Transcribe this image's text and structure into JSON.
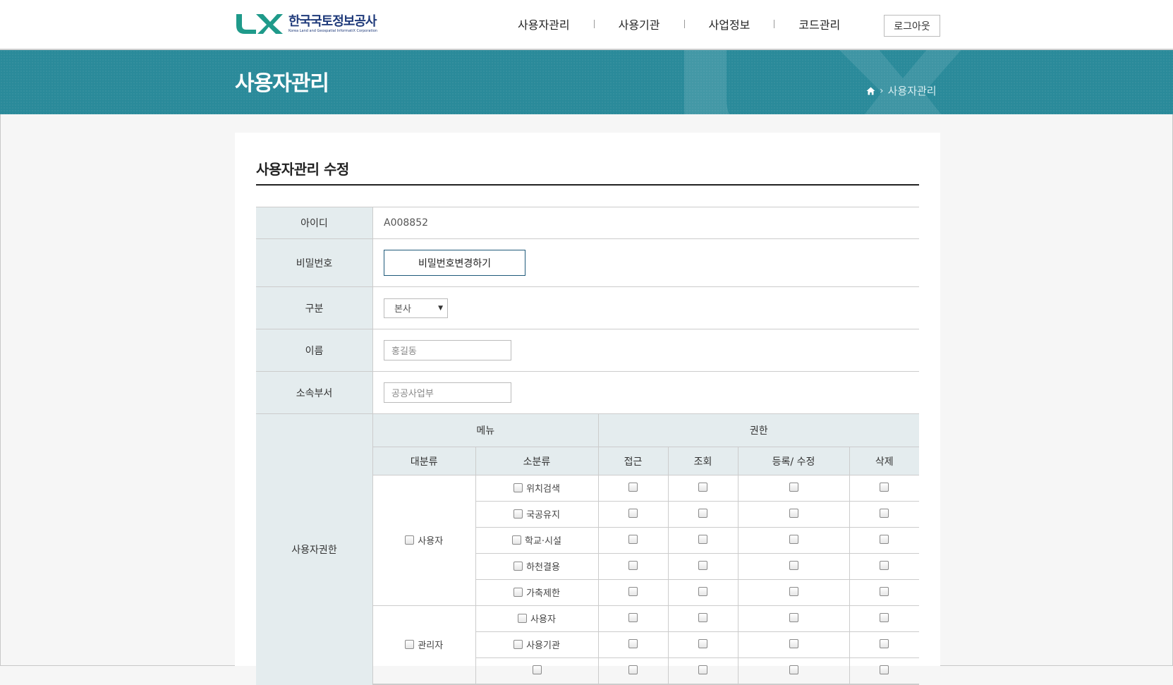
{
  "header": {
    "logo_ko": "한국국토정보공사",
    "logo_en": "Korea Land and Geospatial InformatiX Corporation",
    "nav": [
      "사용자관리",
      "사용기관",
      "사업정보",
      "코드관리"
    ],
    "logout": "로그아웃"
  },
  "banner": {
    "title": "사용자관리",
    "breadcrumb": "사용자관리"
  },
  "panel": {
    "title": "사용자관리 수정"
  },
  "form": {
    "id_label": "아이디",
    "id_value": "A008852",
    "password_label": "비밀번호",
    "password_button": "비밀번호변경하기",
    "type_label": "구분",
    "type_value": "본사",
    "name_label": "이름",
    "name_value": "홍길동",
    "dept_label": "소속부서",
    "dept_value": "공공사업부",
    "perm_label": "사용자권한"
  },
  "permissions": {
    "menu_header": "메뉴",
    "auth_header": "권한",
    "columns": [
      "대분류",
      "소분류",
      "접근",
      "조회",
      "등록/ 수정",
      "삭제"
    ],
    "groups": [
      {
        "name": "사용자",
        "items": [
          "위치검색",
          "국공유지",
          "학교·시설",
          "하천결용",
          "가축제한"
        ]
      },
      {
        "name": "관리자",
        "items": [
          "사용자",
          "사용기관"
        ]
      }
    ]
  },
  "colors": {
    "brand": "#2a8a9a",
    "logo_green": "#1f9a8a",
    "logo_navy": "#1f3a7a"
  }
}
